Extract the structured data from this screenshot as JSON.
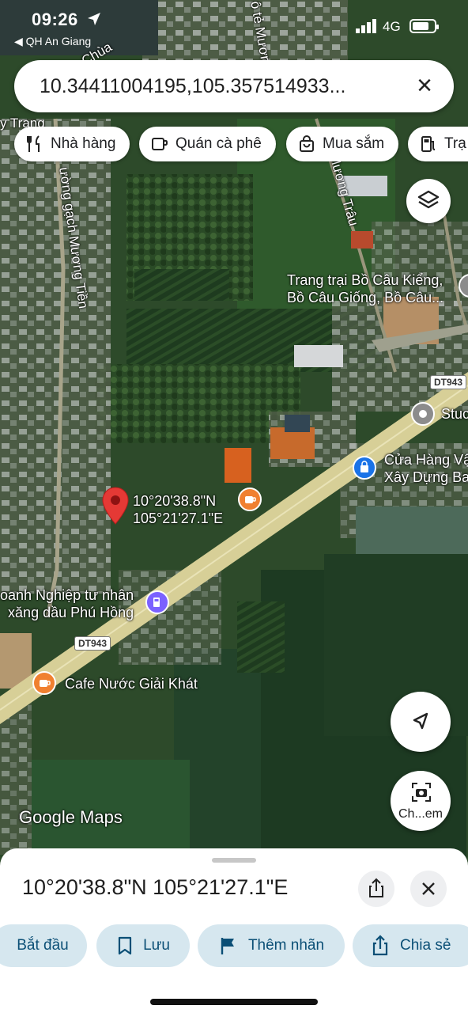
{
  "status": {
    "time": "09:26",
    "back_label": "◀ QH An Giang",
    "network": "4G"
  },
  "search": {
    "query": "10.34411004195,105.357514933...",
    "close": "×"
  },
  "chips": [
    {
      "label": "Nhà hàng",
      "icon": "fork-knife-icon"
    },
    {
      "label": "Quán cà phê",
      "icon": "coffee-cup-icon"
    },
    {
      "label": "Mua sắm",
      "icon": "shopping-bag-icon"
    },
    {
      "label": "Trạ",
      "icon": "gas-pump-icon"
    }
  ],
  "map": {
    "road_labels": {
      "chua": "Chùa",
      "trang": "y Trạng",
      "muong_top": "ô tẻ Mương",
      "muong_trau": "ế Mương Trâu",
      "gach": "ường gạch Mương Tiền"
    },
    "places": {
      "farm_line1": "Trang trại Bồ Câu Kiểng,",
      "farm_line2": "Bồ Câu Giống, Bồ Câu...",
      "studio": "Stuc",
      "store_line1": "Cửa Hàng Vậ",
      "store_line2": "Xây Dựng Ba",
      "gas_line1": "oanh Nghiệp tư nhân",
      "gas_line2": "xăng dầu Phú Hồng",
      "cafe": "Cafe Nước Giải Khát"
    },
    "pin_label_line1": "10°20'38.8\"N",
    "pin_label_line2": "105°21'27.1\"E",
    "route_badge_top": "DT943",
    "route_badge_bottom": "DT943",
    "watermark": "Google Maps",
    "camera_button_label": "Ch...em"
  },
  "sheet": {
    "coordinates": "10°20'38.8\"N 105°21'27.1\"E",
    "actions": [
      {
        "label": "Bắt đầu",
        "icon": ""
      },
      {
        "label": "Lưu",
        "icon": "bookmark-icon"
      },
      {
        "label": "Thêm nhãn",
        "icon": "flag-icon"
      },
      {
        "label": "Chia sẻ",
        "icon": "share-icon"
      }
    ]
  },
  "colors": {
    "accent": "#0b57d0",
    "pin": "#e53935",
    "cafe_poi": "#f08030",
    "shop_poi": "#1a73e8",
    "gas_poi": "#7b61ff",
    "chip_bg": "#ffffff",
    "action_bg": "#d6e7ef"
  }
}
